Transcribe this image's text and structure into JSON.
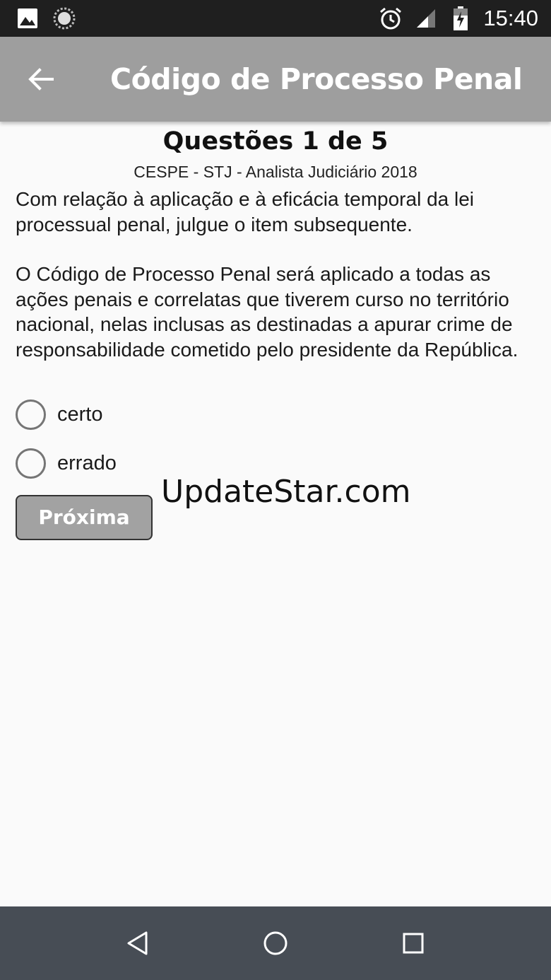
{
  "status_bar": {
    "time": "15:40",
    "left_icons": [
      "image-icon",
      "sync-icon"
    ],
    "right_icons": [
      "alarm-icon",
      "signal-icon",
      "battery-icon"
    ]
  },
  "app_bar": {
    "title": "Código de Processo Penal",
    "back_icon": "arrow-back-icon",
    "background": "#9e9e9e"
  },
  "question": {
    "header": "Questões 1 de 5",
    "source": "CESPE - STJ - Analista Judiciário 2018",
    "intro": "Com relação à aplicação e à eficácia temporal da lei processual penal, julgue o item subsequente.",
    "statement": "O Código de Processo Penal será aplicado a todas as ações penais e correlatas que tiverem curso no território nacional, nelas inclusas as destinadas a apurar crime de responsabilidade cometido pelo presidente da República."
  },
  "options": [
    {
      "label": "certo",
      "selected": false
    },
    {
      "label": "errado",
      "selected": false
    }
  ],
  "next_button": {
    "label": "Próxima"
  },
  "watermark": "UpdateStar.com",
  "nav_bar": {
    "buttons": [
      "back-triangle-icon",
      "home-circle-icon",
      "recents-square-icon"
    ],
    "background": "#474d55"
  }
}
